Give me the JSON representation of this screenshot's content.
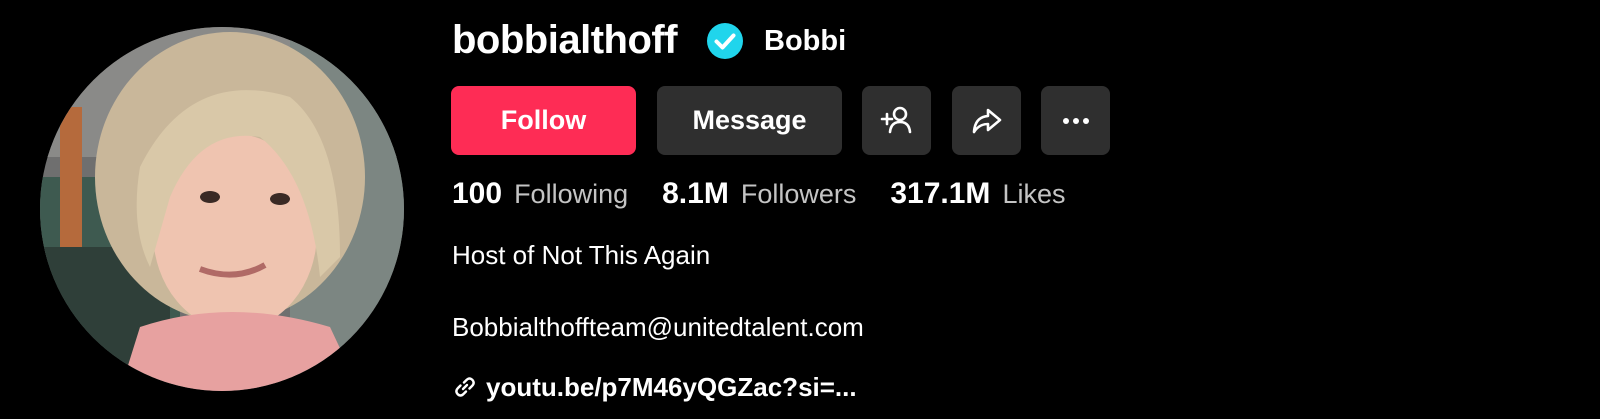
{
  "profile": {
    "username": "bobbialthoff",
    "display_name": "Bobbi",
    "verified": true,
    "avatar_icon": "profile-photo"
  },
  "actions": {
    "follow_label": "Follow",
    "message_label": "Message",
    "add_friend_icon": "person-add-icon",
    "share_icon": "share-arrow-icon",
    "more_icon": "more-dots-icon"
  },
  "stats": {
    "following": {
      "count": "100",
      "label": "Following"
    },
    "followers": {
      "count": "8.1M",
      "label": "Followers"
    },
    "likes": {
      "count": "317.1M",
      "label": "Likes"
    }
  },
  "bio": {
    "line1": "Host of Not This Again",
    "email": "Bobbialthoffteam@unitedtalent.com",
    "link": "youtu.be/p7M46yQGZac?si=..."
  },
  "colors": {
    "background": "#000000",
    "follow_button": "#fe2c55",
    "secondary_button": "#2f2f2f",
    "verified_badge": "#20d5ec",
    "muted_text": "#c4c4c4"
  }
}
